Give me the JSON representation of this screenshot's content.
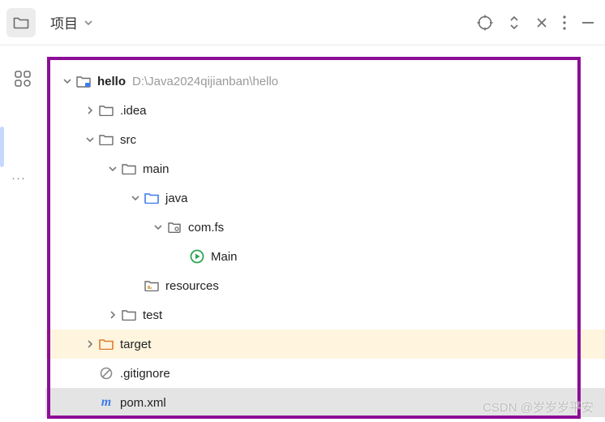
{
  "toolbar": {
    "title": "项目"
  },
  "tree": {
    "root": {
      "name": "hello",
      "path": "D:\\Java2024qijianban\\hello"
    },
    "items": [
      {
        "label": ".idea"
      },
      {
        "label": "src"
      },
      {
        "label": "main"
      },
      {
        "label": "java"
      },
      {
        "label": "com.fs"
      },
      {
        "label": "Main"
      },
      {
        "label": "resources"
      },
      {
        "label": "test"
      },
      {
        "label": "target"
      },
      {
        "label": ".gitignore"
      },
      {
        "label": "pom.xml"
      }
    ]
  },
  "watermark": "CSDN @岁岁岁平安"
}
